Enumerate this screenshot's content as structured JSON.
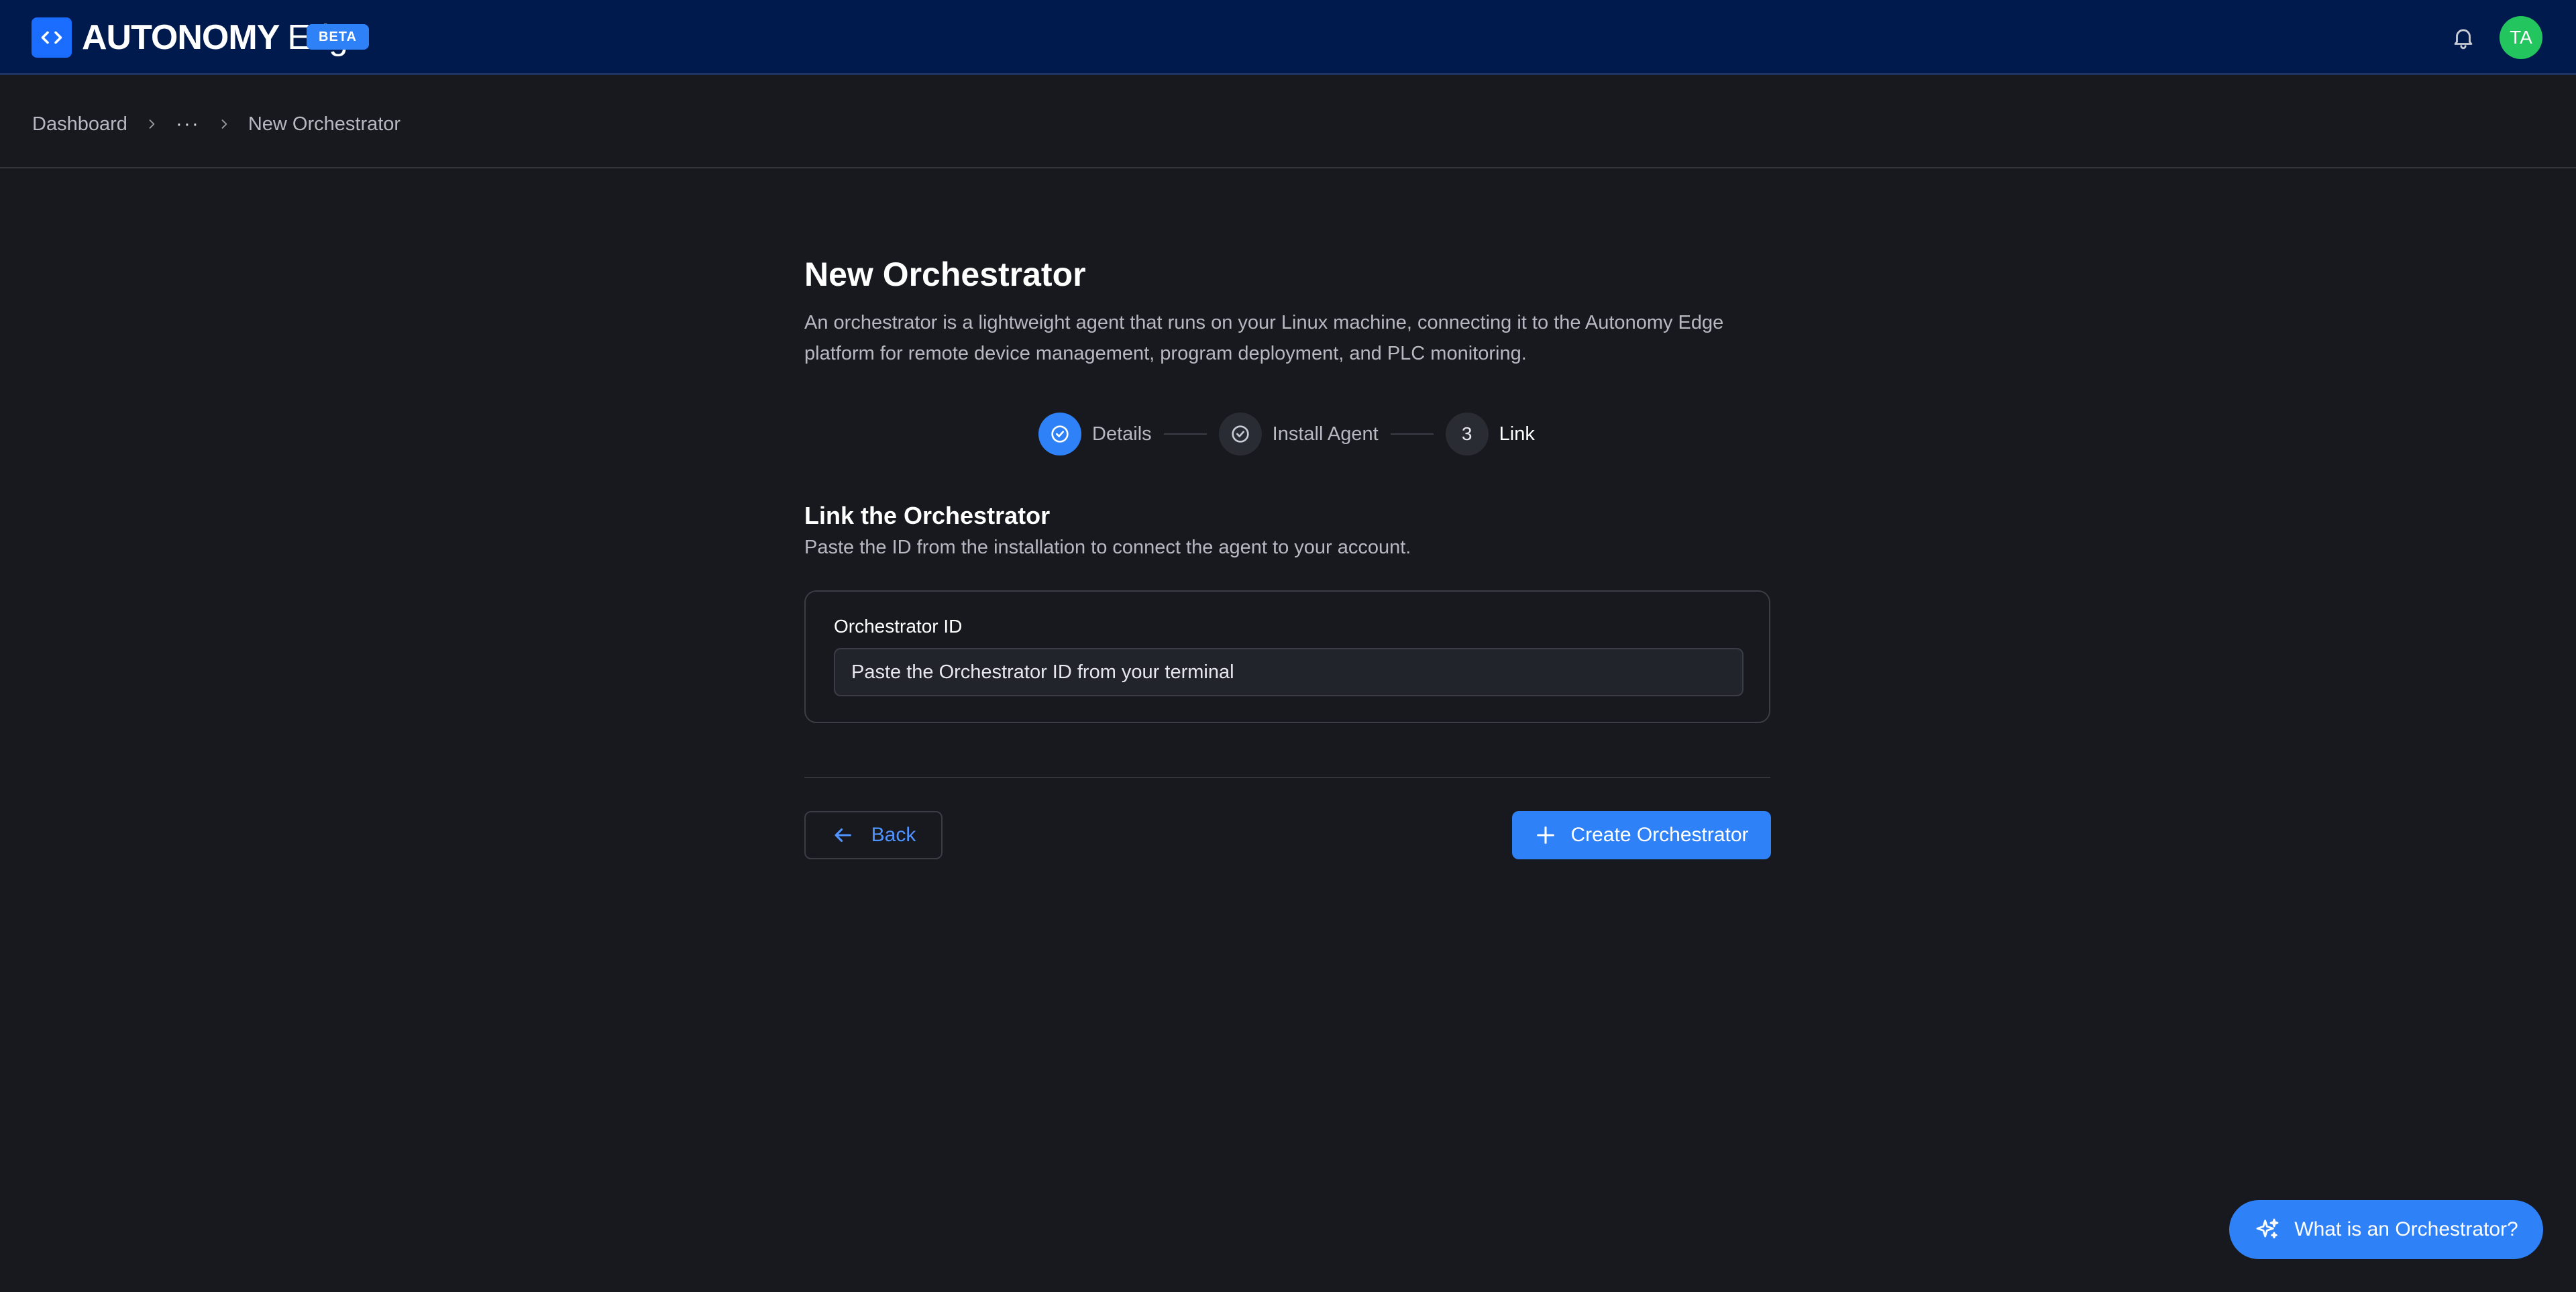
{
  "header": {
    "brand_strong": "AUTONOMY",
    "brand_light": "Edge",
    "badge": "BETA",
    "avatar_initials": "TA"
  },
  "breadcrumb": {
    "items": [
      "Dashboard",
      "···",
      "New Orchestrator"
    ]
  },
  "page": {
    "title": "New Orchestrator",
    "description": "An orchestrator is a lightweight agent that runs on your Linux machine, connecting it to the Autonomy Edge platform for remote device management, program deployment, and PLC monitoring."
  },
  "stepper": {
    "steps": [
      {
        "label": "Details",
        "state": "completed"
      },
      {
        "label": "Install Agent",
        "state": "completed"
      },
      {
        "label": "Link",
        "number": "3",
        "state": "current"
      }
    ]
  },
  "section": {
    "title": "Link the Orchestrator",
    "description": "Paste the ID from the installation to connect the agent to your account."
  },
  "form": {
    "field_label": "Orchestrator ID",
    "placeholder": "Paste the Orchestrator ID from your terminal",
    "value": ""
  },
  "actions": {
    "back_label": "Back",
    "create_label": "Create Orchestrator"
  },
  "help": {
    "label": "What is an Orchestrator?"
  },
  "colors": {
    "accent": "#2f81f7",
    "header_bg": "#001a4d",
    "page_bg": "#18191e",
    "avatar_bg": "#23c55e"
  }
}
